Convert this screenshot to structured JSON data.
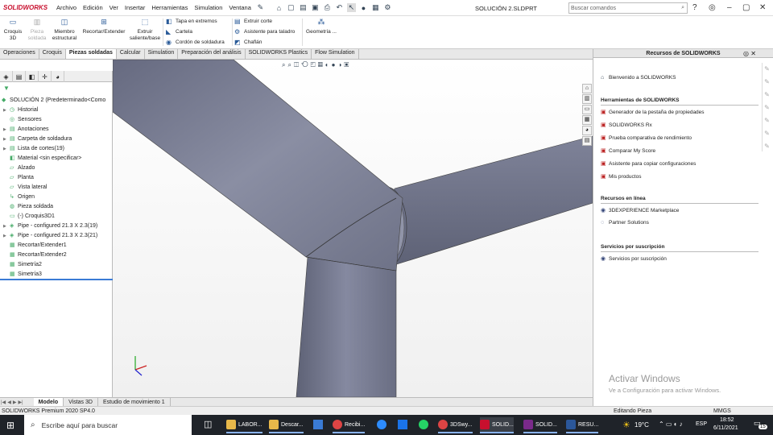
{
  "app": {
    "brand": "SOLIDWORKS",
    "doc_title": "SOLUCIÓN 2.SLDPRT",
    "search_placeholder": "Buscar comandos"
  },
  "menus": [
    "Archivo",
    "Edición",
    "Ver",
    "Insertar",
    "Herramientas",
    "Simulation",
    "Ventana"
  ],
  "command_manager": {
    "buttons": [
      "Croquis 3D",
      "Pieza soldada",
      "Miembro estructural",
      "Recortar/Extender",
      "Extruir saliente/base"
    ],
    "col1": [
      "Tapa en extremos",
      "Cartela",
      "Cordón de soldadura"
    ],
    "col2": [
      "Extruir corte",
      "Asistente para taladro",
      "Chaflán"
    ],
    "geom": "Geometría ..."
  },
  "tabs": [
    "Operaciones",
    "Croquis",
    "Piezas soldadas",
    "Calcular",
    "Simulation",
    "Preparación del análisis",
    "SOLIDWORKS Plastics",
    "Flow Simulation"
  ],
  "tree": {
    "root": "SOLUCIÓN 2  (Predeterminado<Como",
    "items": [
      "Historial",
      "Sensores",
      "Anotaciones",
      "Carpeta de soldadura",
      "Lista de cortes(19)",
      "Material <sin especificar>",
      "Alzado",
      "Planta",
      "Vista lateral",
      "Origen",
      "Pieza soldada",
      "(-) Croquis3D1",
      "Pipe - configured 21.3 X 2.3(19)",
      "Pipe - configured 21.3 X 2.3(21)",
      "Recortar/Extender1",
      "Recortar/Extender2",
      "Simetría2",
      "Simetría3"
    ]
  },
  "task_pane": {
    "title": "Recursos de SOLIDWORKS",
    "welcome": "Bienvenido a SOLIDWORKS",
    "tools_title": "Herramientas de SOLIDWORKS",
    "tools": [
      "Generador de la pestaña de propiedades",
      "SOLIDWORKS Rx",
      "Prueba comparativa de rendimiento",
      "Comparar My Score",
      "Asistente para copiar configuraciones",
      "Mis productos"
    ],
    "online_title": "Recursos en línea",
    "online": [
      "3DEXPERIENCE Marketplace",
      "Partner Solutions"
    ],
    "subs_title": "Servicios por suscripción",
    "subs": [
      "Servicios por suscripción"
    ]
  },
  "watermark": {
    "title": "Activar Windows",
    "sub": "Ve a Configuración para activar Windows."
  },
  "bottom_tabs": [
    "Modelo",
    "Vistas 3D",
    "Estudio de movimiento 1"
  ],
  "status": {
    "left": "SOLIDWORKS Premium 2020 SP4.0",
    "mode": "Editando Pieza",
    "units": "MMGS"
  },
  "taskbar": {
    "search": "Escribe aquí para buscar",
    "apps": [
      "LABOR...",
      "Descar...",
      "Recibi...",
      "3DSwy...",
      "SOLID...",
      "SOLID...",
      "RESU..."
    ],
    "temp": "19°C",
    "lang": "ESP",
    "time": "18:52",
    "date": "6/11/2021",
    "notif": "15"
  },
  "colors": {
    "pipe": "#7b7f95",
    "accent": "#c8102e"
  }
}
